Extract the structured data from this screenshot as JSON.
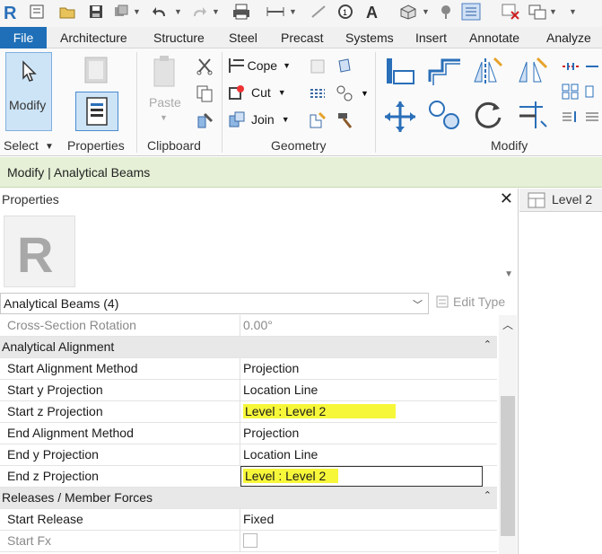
{
  "ribbon_tabs": [
    "File",
    "Architecture",
    "Structure",
    "Steel",
    "Precast",
    "Systems",
    "Insert",
    "Annotate",
    "Analyze"
  ],
  "ribbon": {
    "modify_label": "Modify",
    "select_label": "Select",
    "properties_label": "Properties",
    "clipboard_label": "Clipboard",
    "paste_label": "Paste",
    "geometry_label": "Geometry",
    "modify_group_label": "Modify",
    "cope_label": "Cope",
    "cut_label": "Cut",
    "join_label": "Join"
  },
  "context_bar": "Modify | Analytical Beams",
  "properties": {
    "title": "Properties",
    "type_selector": "Analytical Beams (4)",
    "edit_type": "Edit Type",
    "rows": [
      {
        "key": "Cross-Section Rotation",
        "value": "0.00°"
      },
      {
        "key": "Analytical Alignment",
        "value": ""
      },
      {
        "key": "Start Alignment Method",
        "value": "Projection"
      },
      {
        "key": "Start y Projection",
        "value": "Location Line"
      },
      {
        "key": "Start z Projection",
        "value": "Level : Level 2"
      },
      {
        "key": "End Alignment Method",
        "value": "Projection"
      },
      {
        "key": "End y Projection",
        "value": "Location Line"
      },
      {
        "key": "End z Projection",
        "value": "Level : Level 2"
      },
      {
        "key": "Releases / Member Forces",
        "value": ""
      },
      {
        "key": "Start Release",
        "value": "Fixed"
      },
      {
        "key": "Start Fx",
        "value": ""
      }
    ]
  },
  "view_tab": "Level 2",
  "colors": {
    "file_tab": "#1e6fb8",
    "context_bar": "#e5f0d6",
    "highlight": "#f7f73a",
    "logo_blue": "#2a6fb9"
  }
}
